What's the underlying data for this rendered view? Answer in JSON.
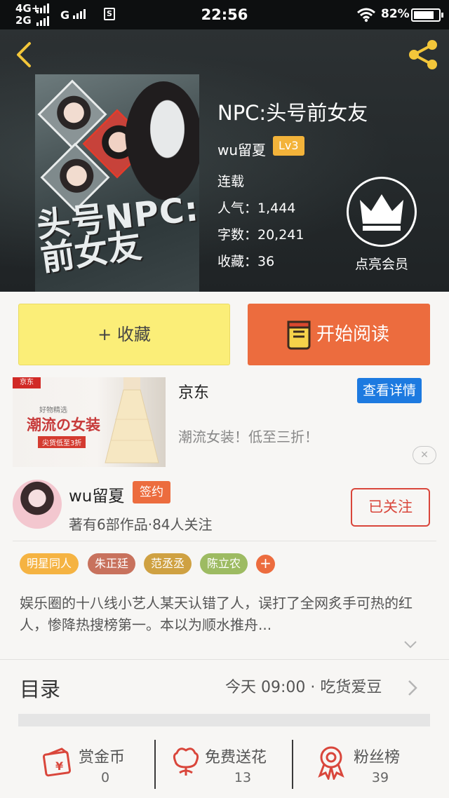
{
  "status_bar": {
    "network1": "4G+",
    "network2": "2G",
    "network3": "G",
    "sim_icon": "S",
    "time": "22:56",
    "battery": "82%",
    "battery_level": 0.82
  },
  "header": {
    "back_icon": "chevron-left-icon",
    "share_icon": "share-icon",
    "cover": {
      "title_line1": "头号NPC:",
      "title_line2": "前女友"
    },
    "book_title": "NPC:头号前女友",
    "author": "wu留夏",
    "level": "Lv3",
    "status": "连载",
    "popularity": "人气：1,444",
    "word_count": "字数：20,241",
    "favorites": "收藏：36",
    "vip_label": "点亮会员"
  },
  "actions": {
    "collect": "+ 收藏",
    "read": "开始阅读"
  },
  "ad": {
    "brand": "京东",
    "detail_button": "查看详情",
    "description": "潮流女装！低至三折！",
    "image_logo": "京东",
    "image_pick": "好物精选",
    "image_headline": "潮流の女装",
    "image_sale": "尖货低至3折",
    "close_icon": "close-icon"
  },
  "author_card": {
    "name": "wu留夏",
    "badge": "签约",
    "works": "著有6部作品·84人关注",
    "follow_button": "已关注"
  },
  "tags": [
    {
      "label": "明星同人",
      "color": "#f5b342"
    },
    {
      "label": "朱正廷",
      "color": "#c8725d"
    },
    {
      "label": "范丞丞",
      "color": "#cfa142"
    },
    {
      "label": "陈立农",
      "color": "#9dbb62"
    }
  ],
  "tag_add": "+",
  "description": "娱乐圈的十八线小艺人某天认错了人，误打了全网炙手可热的红人，惨降热搜榜第一。本以为顺水推舟...",
  "toc": {
    "title": "目录",
    "latest": "今天 09:00 · 吃货爱豆"
  },
  "footer": {
    "reward": {
      "label": "赏金币",
      "count": "0",
      "icon": "gold-coin-icon"
    },
    "flower": {
      "label": "免费送花",
      "count": "13",
      "icon": "flower-icon"
    },
    "fans": {
      "label": "粉丝榜",
      "count": "39",
      "icon": "ribbon-medal-icon"
    }
  },
  "colors": {
    "accent_orange": "#ec6c3e",
    "collect_yellow": "#fbee78",
    "ad_blue": "#1d7ae0",
    "follow_red": "#d9463b",
    "level_gold": "#f3b33a"
  }
}
